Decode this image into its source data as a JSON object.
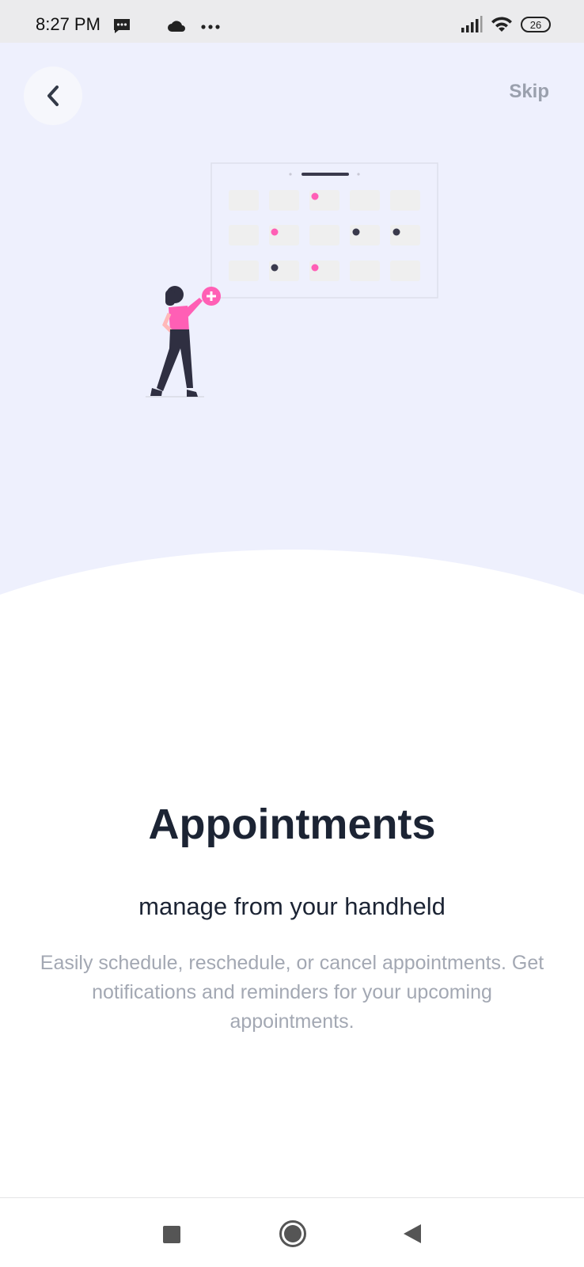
{
  "status_bar": {
    "time": "8:27 PM",
    "battery": "26",
    "icons": [
      "message-icon",
      "cloud-icon",
      "more-icon",
      "signal-icon",
      "wifi-icon",
      "battery-icon"
    ]
  },
  "header": {
    "back_icon": "chevron-left-icon",
    "skip_label": "Skip"
  },
  "content": {
    "title": "Appointments",
    "subtitle": "manage from your handheld",
    "description": "Easily schedule, reschedule, or cancel appointments. Get notifications and reminders for your upcoming appointments."
  },
  "nav_bar": {
    "icons": [
      "recents-square-icon",
      "home-circle-icon",
      "back-triangle-icon"
    ]
  },
  "colors": {
    "hero_background": "#eef0fd",
    "accent_pink": "#ff5fb5",
    "dark_navy": "#1c2434",
    "muted_text": "#a3a8b3"
  }
}
